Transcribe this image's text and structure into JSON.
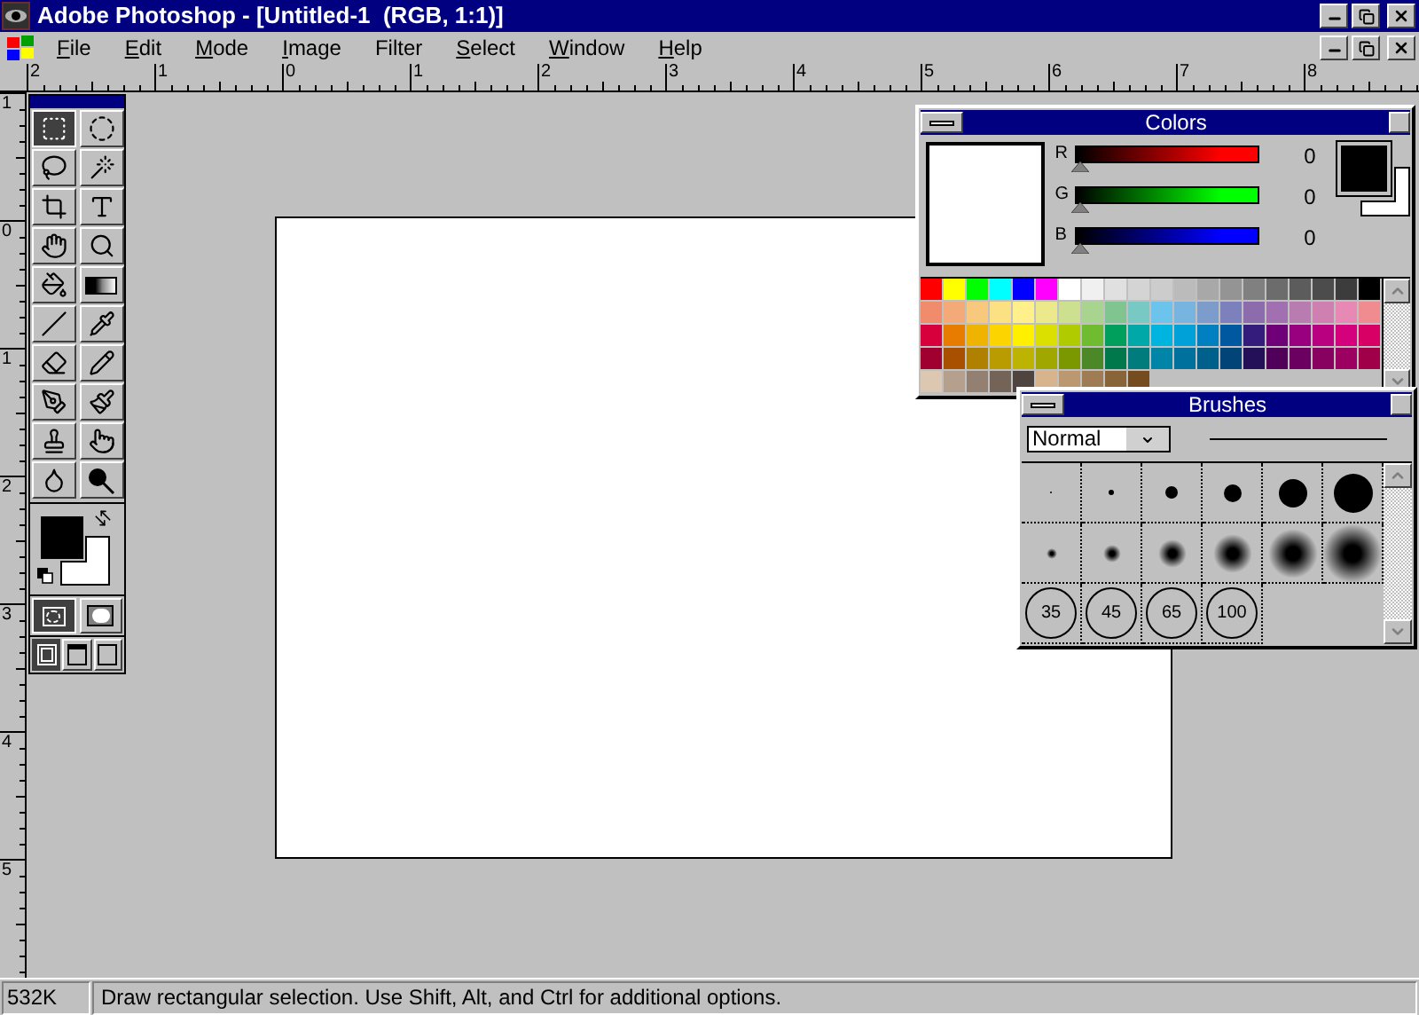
{
  "window": {
    "title": "Adobe Photoshop - [Untitled-1  (RGB, 1:1)]"
  },
  "menu": [
    {
      "key": "F",
      "rest": "ile"
    },
    {
      "key": "E",
      "rest": "dit"
    },
    {
      "key": "M",
      "rest": "ode"
    },
    {
      "key": "I",
      "rest": "mage"
    },
    {
      "rest": "Filter"
    },
    {
      "key": "S",
      "rest": "elect"
    },
    {
      "key": "W",
      "rest": "indow"
    },
    {
      "key": "H",
      "rest": "elp"
    }
  ],
  "rulers": {
    "horizontal": [
      "2",
      "1",
      "0",
      "1",
      "2",
      "3",
      "4",
      "5",
      "6",
      "7",
      "8"
    ],
    "vertical": [
      "1",
      "0",
      "1",
      "2",
      "3",
      "4",
      "5"
    ]
  },
  "toolbox": {
    "tools": [
      {
        "kind": "marquee",
        "selected": true
      },
      {
        "kind": "elliptical",
        "selected": false
      },
      {
        "kind": "lasso",
        "selected": false
      },
      {
        "kind": "wand",
        "selected": false
      },
      {
        "kind": "crop",
        "selected": false
      },
      {
        "kind": "type",
        "selected": false
      },
      {
        "kind": "hand",
        "selected": false
      },
      {
        "kind": "zoom",
        "selected": false
      },
      {
        "kind": "bucket",
        "selected": false
      },
      {
        "kind": "gradient",
        "selected": false
      },
      {
        "kind": "line",
        "selected": false
      },
      {
        "kind": "eyedropper",
        "selected": false
      },
      {
        "kind": "eraser",
        "selected": false
      },
      {
        "kind": "pencil",
        "selected": false
      },
      {
        "kind": "airbrush",
        "selected": false
      },
      {
        "kind": "brush",
        "selected": false
      },
      {
        "kind": "stamp",
        "selected": false
      },
      {
        "kind": "smudge",
        "selected": false
      },
      {
        "kind": "blur",
        "selected": false
      },
      {
        "kind": "burn",
        "selected": false
      }
    ],
    "foreground": {
      "color": "#000000"
    },
    "background": {
      "color": "#ffffff"
    },
    "mask_modes": [
      {
        "kind": "standard",
        "selected": true
      },
      {
        "kind": "quick-mask",
        "selected": false
      }
    ],
    "screen_modes": [
      {
        "kind": "window",
        "selected": true
      },
      {
        "kind": "full-menu",
        "selected": false
      },
      {
        "kind": "full",
        "selected": false
      }
    ]
  },
  "colors_palette": {
    "title": "Colors",
    "preview": {
      "color": "#ffffff"
    },
    "channels": [
      {
        "name": "R",
        "color": "#ff0000",
        "level": 0,
        "reading": "0"
      },
      {
        "name": "G",
        "color": "#00ff00",
        "level": 0,
        "reading": "0"
      },
      {
        "name": "B",
        "color": "#0000ff",
        "level": 0,
        "reading": "0"
      }
    ],
    "foreground": {
      "color": "#000000"
    },
    "background": {
      "color": "#ffffff"
    },
    "swatches": [
      {
        "color": "#ff0000"
      },
      {
        "color": "#ffff00"
      },
      {
        "color": "#00ff00"
      },
      {
        "color": "#00ffff"
      },
      {
        "color": "#0000ff"
      },
      {
        "color": "#ff00ff"
      },
      {
        "color": "#ffffff"
      },
      {
        "color": "#f0f0f0"
      },
      {
        "color": "#e0e0e0"
      },
      {
        "color": "#d4d4d4"
      },
      {
        "color": "#cccccc"
      },
      {
        "color": "#bbbbbb"
      },
      {
        "color": "#a8a8a8"
      },
      {
        "color": "#949494"
      },
      {
        "color": "#808080"
      },
      {
        "color": "#6c6c6c"
      },
      {
        "color": "#5c5c5c"
      },
      {
        "color": "#4c4c4c"
      },
      {
        "color": "#3c3c3c"
      },
      {
        "color": "#000000"
      },
      {
        "color": "#f08c6c"
      },
      {
        "color": "#f4aa78"
      },
      {
        "color": "#f8c87c"
      },
      {
        "color": "#fce084"
      },
      {
        "color": "#fff08c"
      },
      {
        "color": "#ece88c"
      },
      {
        "color": "#cce090"
      },
      {
        "color": "#a8d490"
      },
      {
        "color": "#80c490"
      },
      {
        "color": "#78c8c4"
      },
      {
        "color": "#6cc4ec"
      },
      {
        "color": "#78b4e0"
      },
      {
        "color": "#7c9ccc"
      },
      {
        "color": "#7c80bc"
      },
      {
        "color": "#8c6cac"
      },
      {
        "color": "#a070b0"
      },
      {
        "color": "#b87cb0"
      },
      {
        "color": "#d080b0"
      },
      {
        "color": "#e888b4"
      },
      {
        "color": "#f08c90"
      },
      {
        "color": "#d8003c"
      },
      {
        "color": "#e87c00"
      },
      {
        "color": "#f0b400"
      },
      {
        "color": "#fcd400"
      },
      {
        "color": "#fff000"
      },
      {
        "color": "#dce000"
      },
      {
        "color": "#b0cc00"
      },
      {
        "color": "#70bc30"
      },
      {
        "color": "#00a05c"
      },
      {
        "color": "#00a8a8"
      },
      {
        "color": "#00b4e0"
      },
      {
        "color": "#00a0d8"
      },
      {
        "color": "#0080c0"
      },
      {
        "color": "#0058a0"
      },
      {
        "color": "#341c7c"
      },
      {
        "color": "#700078"
      },
      {
        "color": "#980080"
      },
      {
        "color": "#b80080"
      },
      {
        "color": "#d4007c"
      },
      {
        "color": "#d80064"
      },
      {
        "color": "#a00030"
      },
      {
        "color": "#a85000"
      },
      {
        "color": "#b08000"
      },
      {
        "color": "#b89c00"
      },
      {
        "color": "#bcb400"
      },
      {
        "color": "#a0a800"
      },
      {
        "color": "#7c9800"
      },
      {
        "color": "#4c8828"
      },
      {
        "color": "#00784c"
      },
      {
        "color": "#007c7c"
      },
      {
        "color": "#0084a8"
      },
      {
        "color": "#00709c"
      },
      {
        "color": "#00608c"
      },
      {
        "color": "#004478"
      },
      {
        "color": "#241058"
      },
      {
        "color": "#500058"
      },
      {
        "color": "#6c0060"
      },
      {
        "color": "#880060"
      },
      {
        "color": "#9c0060"
      },
      {
        "color": "#a00048"
      },
      {
        "color": "#dcc8b0"
      },
      {
        "color": "#b4a08c"
      },
      {
        "color": "#948070"
      },
      {
        "color": "#746458"
      },
      {
        "color": "#504440"
      },
      {
        "color": "#d8b48c"
      },
      {
        "color": "#bc9870"
      },
      {
        "color": "#a07c54"
      },
      {
        "color": "#886438"
      },
      {
        "color": "#744c20"
      }
    ]
  },
  "brushes_palette": {
    "title": "Brushes",
    "mode": "Normal",
    "brushes": [
      {
        "kind": "hard"
      },
      {
        "kind": "hard"
      },
      {
        "kind": "hard"
      },
      {
        "kind": "hard"
      },
      {
        "kind": "hard"
      },
      {
        "kind": "hard"
      },
      {
        "kind": "soft"
      },
      {
        "kind": "soft"
      },
      {
        "kind": "soft"
      },
      {
        "kind": "soft"
      },
      {
        "kind": "soft"
      },
      {
        "kind": "soft"
      },
      {
        "kind": "large",
        "label": "35"
      },
      {
        "kind": "large",
        "label": "45"
      },
      {
        "kind": "large",
        "label": "65"
      },
      {
        "kind": "large",
        "label": "100"
      }
    ]
  },
  "status_bar": {
    "memory": "532K",
    "message": "Draw rectangular selection. Use Shift, Alt, and Ctrl for additional options."
  }
}
